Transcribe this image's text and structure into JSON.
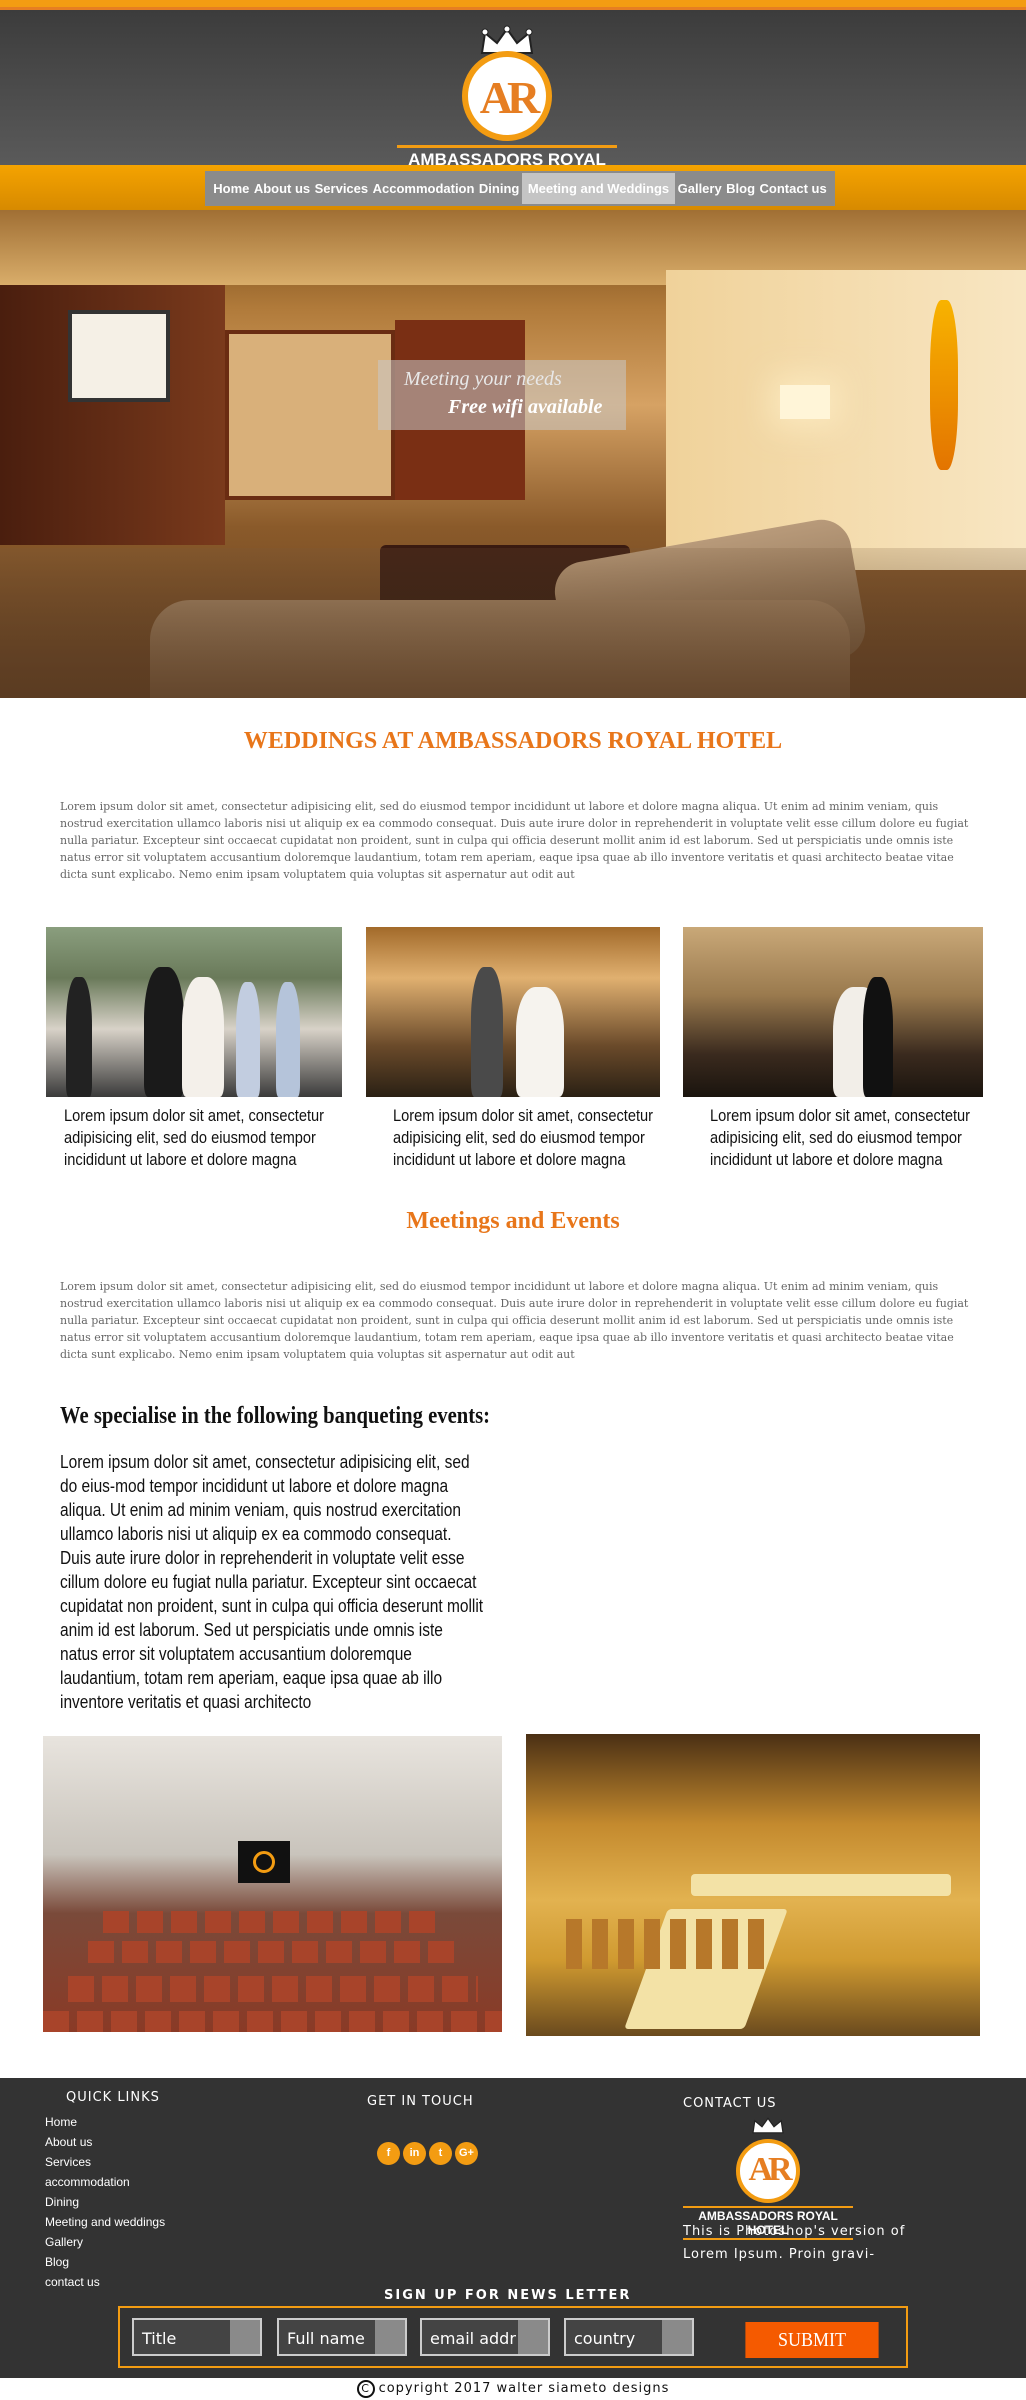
{
  "brand": {
    "name": "AMBASSADORS ROYAL HOTEL",
    "monogram": "AR",
    "accent": "#f39c12",
    "accent_dark": "#e8761a"
  },
  "nav": {
    "items": [
      {
        "label": "Home"
      },
      {
        "label": "About us"
      },
      {
        "label": "Services"
      },
      {
        "label": "Accommodation"
      },
      {
        "label": "Dining"
      },
      {
        "label": "Meeting and Weddings",
        "active": true
      },
      {
        "label": "Gallery"
      },
      {
        "label": "Blog"
      },
      {
        "label": "Contact us"
      }
    ]
  },
  "hero": {
    "line1": "Meeting your needs",
    "line2": "Free wifi available"
  },
  "weddings": {
    "title": "WEDDINGS AT AMBASSADORS ROYAL HOTEL",
    "body": "Lorem ipsum dolor sit amet, consectetur adipisicing elit, sed do eiusmod tempor incididunt ut labore et dolore magna aliqua. Ut enim ad minim veniam, quis nostrud exercitation ullamco laboris nisi ut aliquip ex ea commodo consequat. Duis aute irure dolor in reprehenderit in voluptate velit esse cillum dolore eu fugiat nulla pariatur. Excepteur sint occaecat cupidatat non proident, sunt in culpa qui officia deserunt mollit anim id est laborum. Sed ut perspiciatis unde omnis iste natus error sit voluptatem accusantium doloremque laudantium, totam rem aperiam, eaque ipsa quae ab illo inventore veritatis et quasi architecto beatae vitae dicta sunt explicabo. Nemo enim ipsam voluptatem quia voluptas sit aspernatur aut odit aut",
    "captions": [
      "Lorem ipsum dolor sit amet, consectetur adipisicing elit, sed do eiusmod tempor incididunt ut labore et dolore magna",
      "Lorem ipsum dolor sit amet, consectetur adipisicing elit, sed do eiusmod tempor incididunt ut labore et dolore magna",
      "Lorem ipsum dolor sit amet, consectetur adipisicing elit, sed do eiusmod tempor incididunt ut labore et dolore magna"
    ]
  },
  "meetings": {
    "title": "Meetings and Events",
    "body": "Lorem ipsum dolor sit amet, consectetur adipisicing elit, sed do eiusmod tempor incididunt ut labore et dolore magna aliqua. Ut enim ad minim veniam, quis nostrud exercitation ullamco laboris nisi ut aliquip ex ea commodo consequat. Duis aute irure dolor in reprehenderit in voluptate velit esse cillum dolore eu fugiat nulla pariatur. Excepteur sint occaecat cupidatat non proident, sunt in culpa qui officia deserunt mollit anim id est laborum. Sed ut perspiciatis unde omnis iste natus error sit voluptatem accusantium doloremque laudantium, totam rem aperiam, eaque ipsa quae ab illo inventore veritatis et quasi architecto beatae vitae dicta sunt explicabo. Nemo enim ipsam voluptatem quia voluptas sit aspernatur aut odit aut",
    "banquet_title": "We specialise in the following banqueting events:",
    "banquet_body": "Lorem ipsum dolor sit amet, consectetur adipisicing elit, sed do eius-mod tempor incididunt ut labore et dolore magna aliqua. Ut enim ad minim veniam, quis nostrud exercitation ullamco laboris nisi ut aliquip ex ea commodo consequat. Duis aute irure dolor in reprehenderit in voluptate velit esse cillum dolore eu fugiat nulla pariatur. Excepteur sint occaecat cupidatat non proident, sunt in culpa qui officia deserunt mollit anim id est laborum. Sed ut perspiciatis unde omnis iste natus error sit voluptatem accusantium doloremque laudantium, totam rem aperiam, eaque ipsa quae ab illo inventore veritatis et quasi architecto"
  },
  "footer": {
    "quick_links_title": "QUICK LINKS",
    "quick_links": [
      "Home",
      "About us",
      "Services",
      "accommodation",
      "Dining",
      "Meeting and weddings",
      "Gallery",
      "Blog",
      "contact us"
    ],
    "get_in_touch_title": "GET IN TOUCH",
    "social": [
      {
        "icon": "facebook-icon",
        "glyph": "f"
      },
      {
        "icon": "linkedin-icon",
        "glyph": "in"
      },
      {
        "icon": "twitter-icon",
        "glyph": "t"
      },
      {
        "icon": "google-plus-icon",
        "glyph": "G+"
      }
    ],
    "contact_title": "CONTACT US",
    "contact_text": "This is Photoshop's version of Lorem Ipsum. Proin gravi-",
    "newsletter_title": "SIGN UP FOR NEWS LETTER",
    "fields": [
      {
        "value": "Title"
      },
      {
        "value": "Full name"
      },
      {
        "value": "email addr"
      },
      {
        "value": "country"
      }
    ],
    "submit_label": "SUBMIT",
    "copyright_symbol": "C",
    "copyright": "copyright 2017  walter siameto designs"
  }
}
